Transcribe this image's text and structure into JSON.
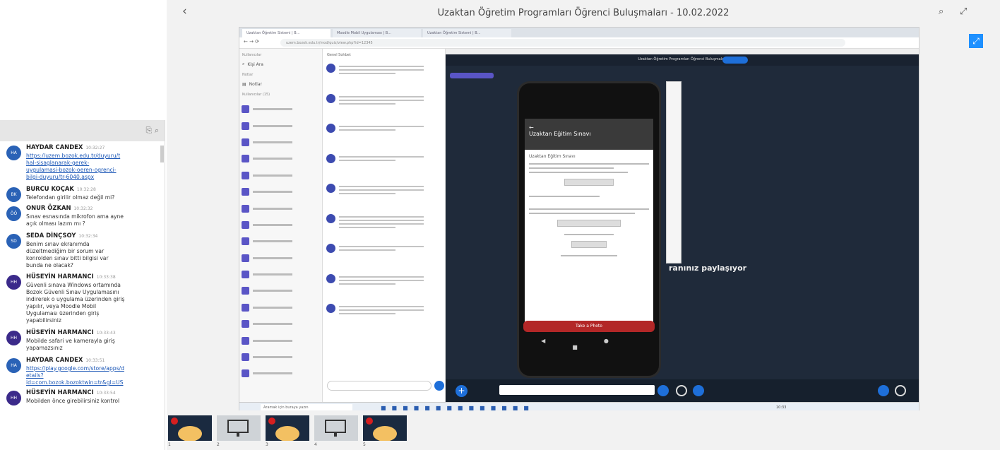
{
  "header": {
    "title": "Uzaktan Öğretim Programları Öğrenci Buluşmaları - 10.02.2022",
    "back_icon": "chevron-left-icon",
    "search_icon": "search-icon",
    "layout_icon": "layout-icon",
    "expand_icon": "expand-icon"
  },
  "chat": {
    "messages": [
      {
        "initials": "HA",
        "name": "HAYDAR CANDEX",
        "time": "10:32:27",
        "lines": [
          "https://uzem.bozok.edu.tr/duyuru/t",
          "hal-sisaglanarak-gerek-",
          "uygulamasi-bozok-oeren-ogrenci-",
          "bilgi-duyuru/tr-6040.aspx"
        ],
        "link": true
      },
      {
        "initials": "BK",
        "name": "BURCU KOÇAK",
        "time": "10:32:28",
        "lines": [
          "Telefondan girilir olmaz değil mi?"
        ],
        "link": false
      },
      {
        "initials": "ÖÖ",
        "name": "ONUR ÖZKAN",
        "time": "10:32:32",
        "lines": [
          "Sınav esnasında mikrofon ama ayne",
          "açık olması lazım mı ?"
        ],
        "link": false
      },
      {
        "initials": "SD",
        "name": "SEDA DİNÇSOY",
        "time": "10:32:34",
        "lines": [
          "Benim sınav ekranımda",
          "düzeltmediğim bir sorum var",
          "konrolden sınav bitti bilgisi var",
          "bunda ne olacak?"
        ],
        "link": false
      },
      {
        "initials": "HH",
        "name": "HÜSEYİN HARMANCI",
        "time": "10:33:38",
        "lines": [
          "Güvenli sınava Windows ortamında",
          "Bozok Güvenli Sınav Uygulamasını",
          "indirerek o uygulama üzerinden giriş",
          "yapılır, veya Moodle Mobil",
          "Uygulaması üzerinden giriş",
          "yapabilirsiniz"
        ],
        "link": false
      },
      {
        "initials": "HH",
        "name": "HÜSEYİN HARMANCI",
        "time": "10:33:43",
        "lines": [
          "Mobilde safari ve kamerayla giriş",
          "yapamazsınız"
        ],
        "link": false
      },
      {
        "initials": "HA",
        "name": "HAYDAR CANDEX",
        "time": "10:33:51",
        "lines": [
          "https://play.google.com/store/apps/d",
          "etails?",
          "id=com.bozok.bozoktwin=tr&gl=US"
        ],
        "link": true
      },
      {
        "initials": "HH",
        "name": "HÜSEYİN HARMANCI",
        "time": "10:33:54",
        "lines": [
          "Mobilden önce girebilirsiniz kontrol"
        ],
        "link": false
      }
    ]
  },
  "shared": {
    "tabs": [
      "Uzaktan Öğretim Sistemi | B...",
      "Moodle Mobil Uygulaması | B...",
      "Uzaktan Öğretim Sistemi | B...",
      ""
    ],
    "address": "uzem.bozok.edu.tr/mod/quiz/view.php?id=12345",
    "sidebar": {
      "header": "Kullanıcılar",
      "search_label": "Kişi Ara",
      "notes_header": "Notlar",
      "notes_label": "Notlar",
      "users_header": "Kullanıcılar (15)"
    },
    "chat_header": "Genel Sohbet",
    "meeting_title": "Uzaktan Öğretim Programları Öğrenci Buluşmaları",
    "phone": {
      "head": "Uzaktan Eğitim Sınavı",
      "quiz_title": "Uzaktan Eğitim Sınavı",
      "bottom_button": "Take a Photo",
      "nav": "◀ ● ■"
    },
    "share_text": "ranınız paylaşıyor",
    "taskbar_search": "Aramak için buraya yazın",
    "taskbar_time": "10:33"
  },
  "thumbs": [
    {
      "label": "1",
      "type": "cam"
    },
    {
      "label": "2",
      "type": "monitor"
    },
    {
      "label": "3",
      "type": "cam"
    },
    {
      "label": "4",
      "type": "monitor"
    },
    {
      "label": "5",
      "type": "cam"
    }
  ]
}
